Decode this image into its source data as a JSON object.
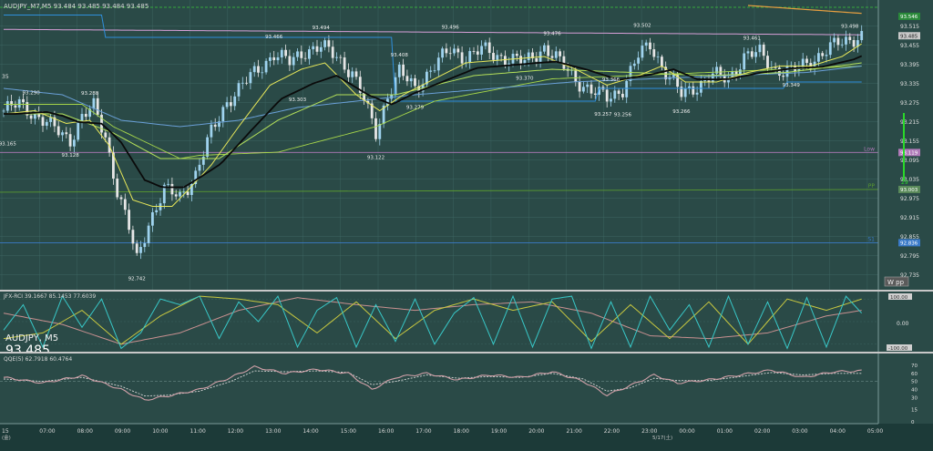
{
  "colors": {
    "background": "#2a4a47",
    "outer": "#1c3a38",
    "grid": "#416b67",
    "bull_candle": "#9fd3ee",
    "bear_candle": "#e6e6e6",
    "ma_black": "#0a0a0a",
    "ma_yellow": "#e8e85a",
    "ma_lime": "#b4e05a",
    "ma_blue": "#6aa0d8",
    "step_blue": "#2f8fdc",
    "step_lime": "#a8d84a",
    "pink_line": "#d8a0d8",
    "orange_line": "#e8a040",
    "low_line": "#b07ab8",
    "pp_line": "#5a9a30",
    "s1_line": "#3a7ac8",
    "rci_cyan": "#38c8c8",
    "rci_yellow": "#c8c840",
    "rci_pink": "#c89090",
    "qqe_main": "#d0a0a8",
    "qqe_signal": "#d8d8d8"
  },
  "header": {
    "symbol_line": "AUDJPY_M7,M5  93.484 93.485 93.484 93.485"
  },
  "price_panel": {
    "ylim": [
      92.7,
      93.58
    ],
    "axis_ticks": [
      "93.515",
      "93.455",
      "93.395",
      "93.335",
      "93.275",
      "93.215",
      "93.155",
      "93.095",
      "93.035",
      "92.975",
      "92.915",
      "92.855",
      "92.795",
      "92.735"
    ],
    "price_boxes": [
      {
        "label": "93.546",
        "value": 93.546,
        "color": "#2a8a3a"
      },
      {
        "label": "93.485",
        "value": 93.485,
        "color": "#c8c8c8"
      },
      {
        "label": "93.119",
        "value": 93.119,
        "color": "#b07ab8"
      },
      {
        "label": "93.003",
        "value": 93.003,
        "color": "#5a8a5a"
      },
      {
        "label": "92.836",
        "value": 92.836,
        "color": "#3a7ac8"
      }
    ],
    "line_labels": {
      "low": "Low",
      "pp": "PP",
      "s1": "S1",
      "side": "W pp",
      "vert": "29"
    },
    "peak_labels": [
      {
        "text": "93.290",
        "i": 7,
        "v": 93.29,
        "pos": "top"
      },
      {
        "text": "93.288",
        "i": 22,
        "v": 93.288,
        "pos": "top"
      },
      {
        "text": "93.466",
        "i": 69,
        "v": 93.466,
        "pos": "top"
      },
      {
        "text": "93.494",
        "i": 81,
        "v": 93.494,
        "pos": "top"
      },
      {
        "text": "93.408",
        "i": 101,
        "v": 93.408,
        "pos": "top"
      },
      {
        "text": "93.496",
        "i": 114,
        "v": 93.496,
        "pos": "top"
      },
      {
        "text": "93.476",
        "i": 140,
        "v": 93.476,
        "pos": "top"
      },
      {
        "text": "93.502",
        "i": 163,
        "v": 93.502,
        "pos": "top"
      },
      {
        "text": "93.461",
        "i": 191,
        "v": 93.461,
        "pos": "top"
      },
      {
        "text": "93.498",
        "i": 216,
        "v": 93.498,
        "pos": "top"
      },
      {
        "text": "93.303",
        "i": 75,
        "v": 93.303,
        "pos": "bottom"
      },
      {
        "text": "93.370",
        "i": 133,
        "v": 93.37,
        "pos": "bottom"
      },
      {
        "text": "93.366",
        "i": 155,
        "v": 93.366,
        "pos": "bottom"
      }
    ],
    "trough_labels": [
      {
        "text": "93.165",
        "i": 1,
        "v": 93.165
      },
      {
        "text": "93.128",
        "i": 17,
        "v": 93.128
      },
      {
        "text": "92.742",
        "i": 34,
        "v": 92.742
      },
      {
        "text": "93.122",
        "i": 95,
        "v": 93.122
      },
      {
        "text": "93.279",
        "i": 105,
        "v": 93.279
      },
      {
        "text": "93.257",
        "i": 153,
        "v": 93.257
      },
      {
        "text": "93.256",
        "i": 158,
        "v": 93.256
      },
      {
        "text": "93.266",
        "i": 173,
        "v": 93.266
      },
      {
        "text": "93.349",
        "i": 201,
        "v": 93.349
      }
    ],
    "left_cut_label": "35"
  },
  "rci_panel": {
    "title": "JFX-RCI 39.1667 85.1453 77.6039",
    "axis_ticks": [
      "0.00"
    ],
    "top_box": "100.00",
    "bottom_box": "-100.00"
  },
  "qqe_panel": {
    "title": "QQE(5) 62.7918 60.4764",
    "axis_ticks": [
      "70",
      "60",
      "50",
      "40",
      "30",
      "15",
      "0"
    ]
  },
  "overlay": {
    "symbol_tf": "AUDJPY, M5",
    "price": "93.485"
  },
  "time_axis": {
    "labels": [
      "15",
      "07:00",
      "08:00",
      "09:00",
      "10:00",
      "11:00",
      "12:00",
      "13:00",
      "14:00",
      "15:00",
      "16:00",
      "17:00",
      "18:00",
      "19:00",
      "20:00",
      "21:00",
      "22:00",
      "23:00",
      "00:00",
      "01:00",
      "02:00",
      "03:00",
      "04:00",
      "05:00"
    ],
    "sub_left": "(金)",
    "sub_right": "5/17(土)"
  },
  "chart_data": {
    "type": "candlestick",
    "symbol": "AUDJPY",
    "timeframe": "M5",
    "control_points": [
      [
        0,
        93.25
      ],
      [
        4,
        93.27
      ],
      [
        8,
        93.24
      ],
      [
        12,
        93.2
      ],
      [
        17,
        93.16
      ],
      [
        20,
        93.23
      ],
      [
        23,
        93.26
      ],
      [
        26,
        93.17
      ],
      [
        29,
        93.0
      ],
      [
        32,
        92.88
      ],
      [
        34,
        92.78
      ],
      [
        37,
        92.9
      ],
      [
        41,
        93.0
      ],
      [
        45,
        92.98
      ],
      [
        49,
        93.05
      ],
      [
        53,
        93.18
      ],
      [
        57,
        93.28
      ],
      [
        61,
        93.33
      ],
      [
        65,
        93.38
      ],
      [
        69,
        93.43
      ],
      [
        73,
        93.4
      ],
      [
        77,
        93.44
      ],
      [
        81,
        93.45
      ],
      [
        85,
        93.42
      ],
      [
        89,
        93.37
      ],
      [
        92,
        93.28
      ],
      [
        95,
        93.18
      ],
      [
        98,
        93.3
      ],
      [
        101,
        93.37
      ],
      [
        105,
        93.32
      ],
      [
        109,
        93.38
      ],
      [
        114,
        93.44
      ],
      [
        118,
        93.42
      ],
      [
        122,
        93.44
      ],
      [
        127,
        93.42
      ],
      [
        133,
        93.4
      ],
      [
        138,
        93.45
      ],
      [
        142,
        93.4
      ],
      [
        146,
        93.35
      ],
      [
        150,
        93.31
      ],
      [
        154,
        93.29
      ],
      [
        158,
        93.32
      ],
      [
        162,
        93.42
      ],
      [
        165,
        93.46
      ],
      [
        169,
        93.37
      ],
      [
        173,
        93.3
      ],
      [
        177,
        93.33
      ],
      [
        181,
        93.36
      ],
      [
        185,
        93.35
      ],
      [
        189,
        93.42
      ],
      [
        193,
        93.43
      ],
      [
        197,
        93.38
      ],
      [
        201,
        93.37
      ],
      [
        205,
        93.4
      ],
      [
        209,
        93.43
      ],
      [
        213,
        93.46
      ],
      [
        217,
        93.48
      ],
      [
        219,
        93.485
      ]
    ],
    "ma_fast_control": [
      [
        0,
        93.24
      ],
      [
        8,
        93.25
      ],
      [
        16,
        93.21
      ],
      [
        22,
        93.22
      ],
      [
        27,
        93.14
      ],
      [
        33,
        92.97
      ],
      [
        38,
        92.95
      ],
      [
        43,
        92.95
      ],
      [
        47,
        93.0
      ],
      [
        53,
        93.08
      ],
      [
        60,
        93.2
      ],
      [
        68,
        93.33
      ],
      [
        76,
        93.38
      ],
      [
        82,
        93.4
      ],
      [
        90,
        93.3
      ],
      [
        96,
        93.25
      ],
      [
        102,
        93.3
      ],
      [
        110,
        93.35
      ],
      [
        118,
        93.4
      ],
      [
        128,
        93.41
      ],
      [
        138,
        93.42
      ],
      [
        146,
        93.38
      ],
      [
        154,
        93.33
      ],
      [
        162,
        93.36
      ],
      [
        168,
        93.39
      ],
      [
        174,
        93.34
      ],
      [
        182,
        93.34
      ],
      [
        190,
        93.37
      ],
      [
        198,
        93.39
      ],
      [
        206,
        93.39
      ],
      [
        214,
        93.42
      ],
      [
        219,
        93.46
      ]
    ],
    "ma_slow_control": [
      [
        0,
        93.24
      ],
      [
        15,
        93.24
      ],
      [
        28,
        93.18
      ],
      [
        40,
        93.1
      ],
      [
        55,
        93.1
      ],
      [
        70,
        93.22
      ],
      [
        85,
        93.3
      ],
      [
        100,
        93.3
      ],
      [
        120,
        93.36
      ],
      [
        140,
        93.38
      ],
      [
        160,
        93.37
      ],
      [
        180,
        93.36
      ],
      [
        200,
        93.37
      ],
      [
        219,
        93.4
      ]
    ],
    "ma_blue_control": [
      [
        0,
        93.32
      ],
      [
        15,
        93.3
      ],
      [
        30,
        93.22
      ],
      [
        45,
        93.2
      ],
      [
        60,
        93.22
      ],
      [
        75,
        93.26
      ],
      [
        90,
        93.28
      ],
      [
        105,
        93.3
      ],
      [
        125,
        93.32
      ],
      [
        145,
        93.34
      ],
      [
        165,
        93.35
      ],
      [
        185,
        93.36
      ],
      [
        205,
        93.37
      ],
      [
        219,
        93.39
      ]
    ],
    "step_blue_control": [
      [
        0,
        93.55
      ],
      [
        26,
        93.55
      ],
      [
        26,
        93.48
      ],
      [
        100,
        93.48
      ],
      [
        100,
        93.28
      ],
      [
        152,
        93.28
      ],
      [
        152,
        93.32
      ],
      [
        200,
        93.32
      ],
      [
        200,
        93.34
      ],
      [
        219,
        93.34
      ]
    ],
    "step_lime_control": [
      [
        0,
        93.27
      ],
      [
        20,
        93.27
      ],
      [
        28,
        93.2
      ],
      [
        45,
        93.1
      ],
      [
        50,
        93.11
      ],
      [
        70,
        93.12
      ],
      [
        95,
        93.2
      ],
      [
        110,
        93.28
      ],
      [
        140,
        93.35
      ],
      [
        180,
        93.37
      ],
      [
        219,
        93.39
      ]
    ],
    "pink_line": [
      [
        0,
        93.505
      ],
      [
        219,
        93.488
      ]
    ],
    "orange_line": [
      [
        190,
        93.58
      ],
      [
        219,
        93.555
      ]
    ],
    "ref_lines": {
      "low": 93.119,
      "pp": 93.003,
      "s1": 92.836
    },
    "rci_cyan_control": [
      [
        0,
        -30
      ],
      [
        5,
        60
      ],
      [
        10,
        -90
      ],
      [
        15,
        90
      ],
      [
        20,
        -20
      ],
      [
        25,
        80
      ],
      [
        30,
        -95
      ],
      [
        35,
        -40
      ],
      [
        40,
        80
      ],
      [
        45,
        60
      ],
      [
        50,
        90
      ],
      [
        55,
        -60
      ],
      [
        60,
        70
      ],
      [
        65,
        0
      ],
      [
        70,
        90
      ],
      [
        75,
        -90
      ],
      [
        80,
        40
      ],
      [
        85,
        85
      ],
      [
        90,
        -90
      ],
      [
        95,
        60
      ],
      [
        100,
        -70
      ],
      [
        105,
        80
      ],
      [
        110,
        -80
      ],
      [
        115,
        30
      ],
      [
        120,
        85
      ],
      [
        125,
        -80
      ],
      [
        130,
        90
      ],
      [
        135,
        -90
      ],
      [
        140,
        80
      ],
      [
        145,
        90
      ],
      [
        150,
        -95
      ],
      [
        155,
        70
      ],
      [
        160,
        -90
      ],
      [
        165,
        90
      ],
      [
        170,
        -30
      ],
      [
        175,
        60
      ],
      [
        180,
        -90
      ],
      [
        185,
        90
      ],
      [
        190,
        -80
      ],
      [
        195,
        70
      ],
      [
        200,
        -95
      ],
      [
        205,
        85
      ],
      [
        210,
        -90
      ],
      [
        215,
        90
      ],
      [
        219,
        30
      ]
    ],
    "rci_yellow_control": [
      [
        0,
        -60
      ],
      [
        10,
        -40
      ],
      [
        20,
        40
      ],
      [
        30,
        -80
      ],
      [
        40,
        20
      ],
      [
        50,
        90
      ],
      [
        60,
        80
      ],
      [
        70,
        60
      ],
      [
        80,
        -40
      ],
      [
        90,
        70
      ],
      [
        100,
        -60
      ],
      [
        110,
        40
      ],
      [
        120,
        80
      ],
      [
        130,
        40
      ],
      [
        140,
        70
      ],
      [
        150,
        -70
      ],
      [
        160,
        60
      ],
      [
        170,
        -60
      ],
      [
        180,
        70
      ],
      [
        190,
        -80
      ],
      [
        200,
        80
      ],
      [
        210,
        40
      ],
      [
        219,
        80
      ]
    ],
    "rci_pink_control": [
      [
        0,
        30
      ],
      [
        15,
        -10
      ],
      [
        30,
        -80
      ],
      [
        45,
        -40
      ],
      [
        60,
        40
      ],
      [
        75,
        85
      ],
      [
        90,
        60
      ],
      [
        105,
        40
      ],
      [
        120,
        60
      ],
      [
        135,
        70
      ],
      [
        150,
        30
      ],
      [
        165,
        -50
      ],
      [
        180,
        -60
      ],
      [
        195,
        -40
      ],
      [
        210,
        20
      ],
      [
        219,
        40
      ]
    ],
    "qqe_main_control": [
      [
        0,
        55
      ],
      [
        10,
        48
      ],
      [
        20,
        57
      ],
      [
        30,
        40
      ],
      [
        36,
        27
      ],
      [
        42,
        32
      ],
      [
        50,
        40
      ],
      [
        58,
        55
      ],
      [
        64,
        68
      ],
      [
        72,
        60
      ],
      [
        80,
        65
      ],
      [
        88,
        60
      ],
      [
        94,
        40
      ],
      [
        100,
        55
      ],
      [
        108,
        60
      ],
      [
        116,
        52
      ],
      [
        124,
        58
      ],
      [
        132,
        55
      ],
      [
        140,
        62
      ],
      [
        148,
        50
      ],
      [
        154,
        33
      ],
      [
        160,
        45
      ],
      [
        166,
        58
      ],
      [
        172,
        48
      ],
      [
        180,
        52
      ],
      [
        188,
        58
      ],
      [
        196,
        64
      ],
      [
        204,
        55
      ],
      [
        212,
        62
      ],
      [
        219,
        63
      ]
    ],
    "qqe_signal_control": [
      [
        0,
        53
      ],
      [
        10,
        50
      ],
      [
        20,
        55
      ],
      [
        30,
        44
      ],
      [
        36,
        32
      ],
      [
        42,
        33
      ],
      [
        50,
        38
      ],
      [
        58,
        50
      ],
      [
        64,
        63
      ],
      [
        72,
        62
      ],
      [
        80,
        63
      ],
      [
        88,
        61
      ],
      [
        94,
        46
      ],
      [
        100,
        50
      ],
      [
        108,
        58
      ],
      [
        116,
        54
      ],
      [
        124,
        56
      ],
      [
        132,
        55
      ],
      [
        140,
        60
      ],
      [
        148,
        53
      ],
      [
        154,
        38
      ],
      [
        160,
        42
      ],
      [
        166,
        54
      ],
      [
        172,
        51
      ],
      [
        180,
        51
      ],
      [
        188,
        56
      ],
      [
        196,
        61
      ],
      [
        204,
        58
      ],
      [
        212,
        60
      ],
      [
        219,
        60
      ]
    ]
  }
}
